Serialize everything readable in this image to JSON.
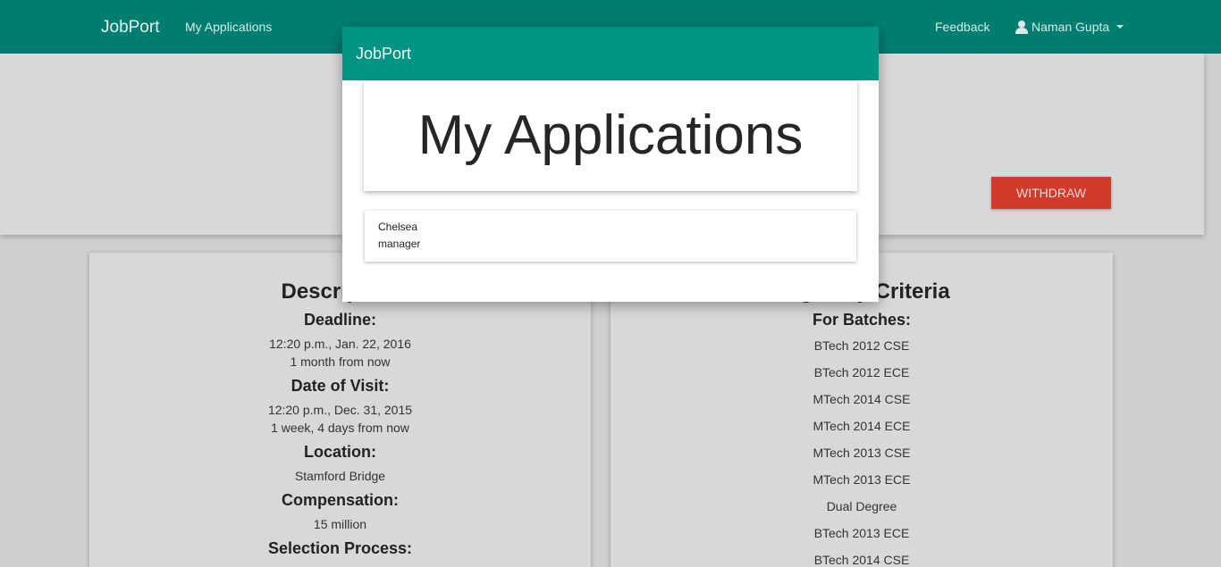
{
  "navbar": {
    "brand": "JobPort",
    "my_applications": "My Applications",
    "feedback": "Feedback",
    "user_name": "Naman Gupta"
  },
  "top_card": {
    "withdraw_label": "WITHDRAW"
  },
  "description": {
    "title": "Description",
    "deadline_label": "Deadline:",
    "deadline_value": "12:20 p.m., Jan. 22, 2016",
    "deadline_relative": "1 month from now",
    "visit_label": "Date of Visit:",
    "visit_value": "12:20 p.m., Dec. 31, 2015",
    "visit_relative": "1 week, 4 days from now",
    "location_label": "Location:",
    "location_value": "Stamford Bridge",
    "compensation_label": "Compensation:",
    "compensation_value": "15 million",
    "selection_label": "Selection Process:"
  },
  "eligibility": {
    "title": "Eligibility Criteria",
    "batches_label": "For Batches:",
    "batches": [
      "BTech 2012 CSE",
      "BTech 2012 ECE",
      "MTech 2014 CSE",
      "MTech 2014 ECE",
      "MTech 2013 CSE",
      "MTech 2013 ECE",
      "Dual Degree",
      "BTech 2013 ECE",
      "BTech 2014 CSE"
    ]
  },
  "modal": {
    "brand": "JobPort",
    "title": "My Applications",
    "applications": [
      {
        "company": "Chelsea",
        "role": "manager"
      }
    ]
  },
  "colors": {
    "navbar": "#007d71",
    "modal_header": "#009485",
    "withdraw": "#d23a2b"
  }
}
